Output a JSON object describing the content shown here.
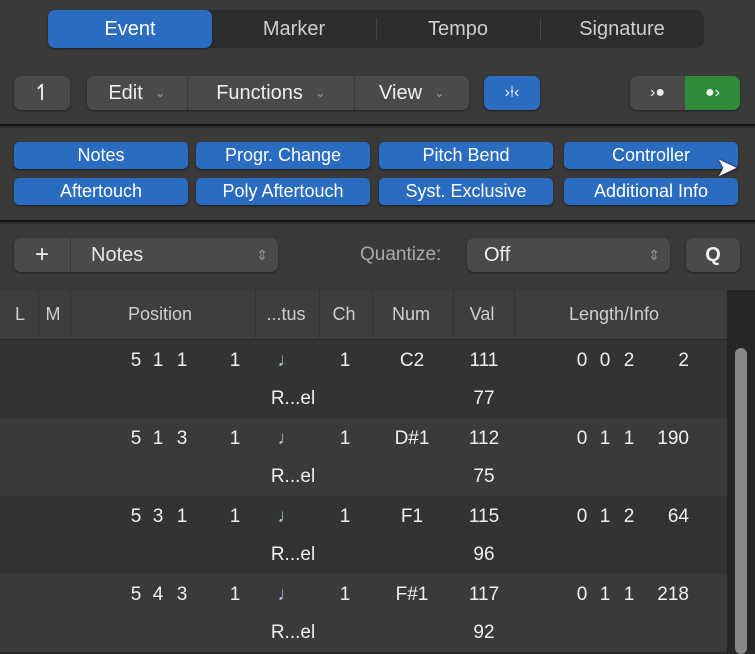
{
  "tabs": [
    {
      "label": "Event",
      "active": true
    },
    {
      "label": "Marker"
    },
    {
      "label": "Tempo"
    },
    {
      "label": "Signature"
    }
  ],
  "toolbar": {
    "up_icon": "arrow-up-turn-icon",
    "menus": [
      "Edit",
      "Functions",
      "View"
    ],
    "catch_icon": "catch-playhead-icon",
    "midi_in_icon": "midi-in-icon",
    "midi_out_icon": "midi-out-icon"
  },
  "filters": [
    "Notes",
    "Progr. Change",
    "Pitch Bend",
    "Controller",
    "Aftertouch",
    "Poly Aftertouch",
    "Syst. Exclusive",
    "Additional Info"
  ],
  "create": {
    "plus": "+",
    "type": "Notes",
    "quantize_label": "Quantize:",
    "quantize_value": "Off",
    "q_button": "Q"
  },
  "columns": [
    "L",
    "M",
    "Position",
    "...tus",
    "Ch",
    "Num",
    "Val",
    "Length/Info"
  ],
  "rows": [
    {
      "pos": [
        "5",
        "1",
        "1",
        "1"
      ],
      "status": "♩",
      "sub_status": "R...el",
      "ch": "1",
      "num": "C2",
      "val": "111",
      "sub_val": "77",
      "len": [
        "0",
        "0",
        "2",
        "2"
      ]
    },
    {
      "pos": [
        "5",
        "1",
        "3",
        "1"
      ],
      "status": "♩",
      "sub_status": "R...el",
      "ch": "1",
      "num": "D#1",
      "val": "112",
      "sub_val": "75",
      "len": [
        "0",
        "1",
        "1",
        "190"
      ]
    },
    {
      "pos": [
        "5",
        "3",
        "1",
        "1"
      ],
      "status": "♩",
      "sub_status": "R...el",
      "ch": "1",
      "num": "F1",
      "val": "115",
      "sub_val": "96",
      "len": [
        "0",
        "1",
        "2",
        "64"
      ]
    },
    {
      "pos": [
        "5",
        "4",
        "3",
        "1"
      ],
      "status": "♩",
      "sub_status": "R...el",
      "ch": "1",
      "num": "F#1",
      "val": "117",
      "sub_val": "92",
      "len": [
        "0",
        "1",
        "1",
        "218"
      ]
    }
  ],
  "colors": {
    "accent": "#2a6cc0",
    "midi_out": "#2e8b3a"
  }
}
